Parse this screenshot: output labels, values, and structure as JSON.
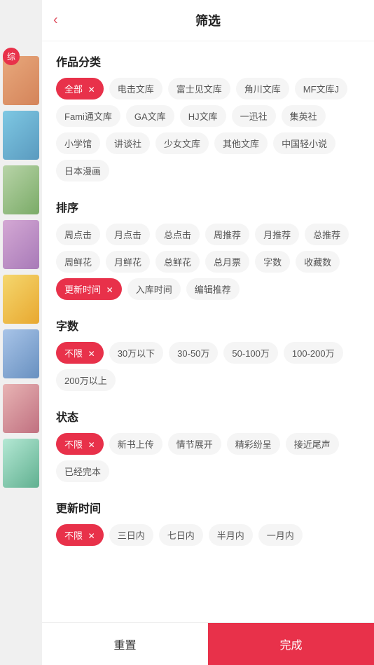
{
  "header": {
    "title": "筛选",
    "back_icon": "‹"
  },
  "sections": [
    {
      "id": "category",
      "title": "作品分类",
      "tags": [
        {
          "label": "全部",
          "active": true,
          "hasClose": true
        },
        {
          "label": "电击文库",
          "active": false
        },
        {
          "label": "富士见文库",
          "active": false
        },
        {
          "label": "角川文库",
          "active": false
        },
        {
          "label": "MF文库J",
          "active": false
        },
        {
          "label": "Fami通文库",
          "active": false
        },
        {
          "label": "GA文库",
          "active": false
        },
        {
          "label": "HJ文库",
          "active": false
        },
        {
          "label": "一迅社",
          "active": false
        },
        {
          "label": "集英社",
          "active": false
        },
        {
          "label": "小学馆",
          "active": false
        },
        {
          "label": "讲谈社",
          "active": false
        },
        {
          "label": "少女文库",
          "active": false
        },
        {
          "label": "其他文库",
          "active": false
        },
        {
          "label": "中国轻小说",
          "active": false
        },
        {
          "label": "日本漫画",
          "active": false
        }
      ]
    },
    {
      "id": "sort",
      "title": "排序",
      "tags": [
        {
          "label": "周点击",
          "active": false
        },
        {
          "label": "月点击",
          "active": false
        },
        {
          "label": "总点击",
          "active": false
        },
        {
          "label": "周推荐",
          "active": false
        },
        {
          "label": "月推荐",
          "active": false
        },
        {
          "label": "总推荐",
          "active": false
        },
        {
          "label": "周鲜花",
          "active": false
        },
        {
          "label": "月鲜花",
          "active": false
        },
        {
          "label": "总鲜花",
          "active": false
        },
        {
          "label": "总月票",
          "active": false
        },
        {
          "label": "字数",
          "active": false
        },
        {
          "label": "收藏数",
          "active": false
        },
        {
          "label": "更新时间",
          "active": true,
          "hasClose": true
        },
        {
          "label": "入库时间",
          "active": false
        },
        {
          "label": "编辑推荐",
          "active": false
        }
      ]
    },
    {
      "id": "wordcount",
      "title": "字数",
      "tags": [
        {
          "label": "不限",
          "active": true,
          "hasClose": true
        },
        {
          "label": "30万以下",
          "active": false
        },
        {
          "label": "30-50万",
          "active": false
        },
        {
          "label": "50-100万",
          "active": false
        },
        {
          "label": "100-200万",
          "active": false
        },
        {
          "label": "200万以上",
          "active": false
        }
      ]
    },
    {
      "id": "status",
      "title": "状态",
      "tags": [
        {
          "label": "不限",
          "active": true,
          "hasClose": true
        },
        {
          "label": "新书上传",
          "active": false
        },
        {
          "label": "情节展开",
          "active": false
        },
        {
          "label": "精彩纷呈",
          "active": false
        },
        {
          "label": "接近尾声",
          "active": false
        },
        {
          "label": "已经完本",
          "active": false
        }
      ]
    },
    {
      "id": "update_time",
      "title": "更新时间",
      "tags": [
        {
          "label": "不限",
          "active": true,
          "hasClose": true
        },
        {
          "label": "三日内",
          "active": false
        },
        {
          "label": "七日内",
          "active": false
        },
        {
          "label": "半月内",
          "active": false
        },
        {
          "label": "一月内",
          "active": false
        }
      ]
    }
  ],
  "bottom": {
    "reset_label": "重置",
    "confirm_label": "完成"
  },
  "sidebar": {
    "tab_label": "综",
    "images": [
      "img1",
      "img2",
      "img3",
      "img4",
      "img5",
      "img6",
      "img7",
      "img8"
    ]
  }
}
